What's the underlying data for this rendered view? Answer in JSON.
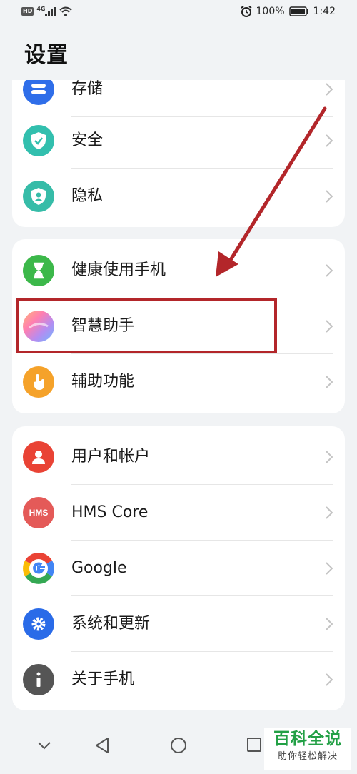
{
  "status_bar": {
    "hd": "HD",
    "network": "4G",
    "battery_percent": "100%",
    "time": "1:42",
    "icons": [
      "signal-icon",
      "wifi-icon",
      "alarm-icon",
      "battery-icon"
    ]
  },
  "page": {
    "title": "设置"
  },
  "groups": [
    {
      "items": [
        {
          "label": "存储",
          "icon": "storage-icon",
          "color": "#2f6ee9"
        },
        {
          "label": "安全",
          "icon": "security-shield-icon",
          "color": "#32bfae"
        },
        {
          "label": "隐私",
          "icon": "privacy-icon",
          "color": "#36bca8"
        }
      ]
    },
    {
      "items": [
        {
          "label": "健康使用手机",
          "icon": "hourglass-icon",
          "color": "#3cb84a"
        },
        {
          "label": "智慧助手",
          "icon": "assistant-icon",
          "color": "#b68cf0"
        },
        {
          "label": "辅助功能",
          "icon": "accessibility-hand-icon",
          "color": "#f5a22a"
        }
      ]
    },
    {
      "items": [
        {
          "label": "用户和帐户",
          "icon": "user-icon",
          "color": "#e94335"
        },
        {
          "label": "HMS Core",
          "icon": "hms-icon",
          "color": "#e45a58"
        },
        {
          "label": "Google",
          "icon": "google-icon",
          "color": "#ffffff"
        },
        {
          "label": "系统和更新",
          "icon": "settings-gear-icon",
          "color": "#2a6be8"
        },
        {
          "label": "关于手机",
          "icon": "info-icon",
          "color": "#555555"
        }
      ]
    }
  ],
  "hms_icon_text": "HMS",
  "annotation": {
    "highlight_color": "#b3262a"
  },
  "nav_bar": {
    "icons": [
      "collapse-down-icon",
      "back-icon",
      "home-icon",
      "recents-icon"
    ]
  },
  "watermark": {
    "title": "百科全说",
    "subtitle": "助你轻松解决"
  }
}
